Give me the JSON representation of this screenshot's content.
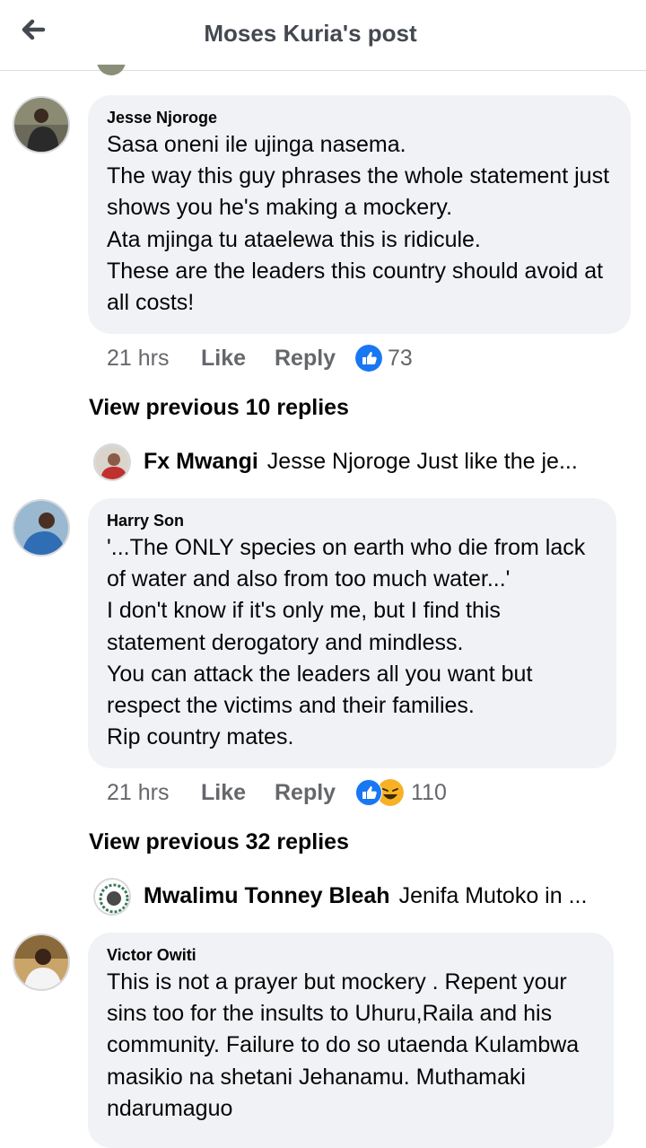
{
  "header": {
    "title": "Moses Kuria's post"
  },
  "comments": [
    {
      "name": "Jesse Njoroge",
      "text": "Sasa oneni ile ujinga nasema.\nThe way this guy phrases the whole statement just shows you he's making a mockery.\nAta mjinga tu ataelewa this is ridicule.\nThese are the leaders this country should avoid at all costs!",
      "time": "21 hrs",
      "like_label": "Like",
      "reply_label": "Reply",
      "reaction_count": "73",
      "view_previous": "View previous 10 replies",
      "latest_reply": {
        "name": "Fx Mwangi",
        "text": "Jesse Njoroge Just like the je..."
      }
    },
    {
      "name": "Harry Son",
      "text": "'...The ONLY species on earth who die from lack of water and also from too much water...'\nI don't know if it's only me, but I find this statement derogatory and mindless.\nYou can attack the leaders all you want but respect the victims and their families.\nRip country mates.",
      "time": "21 hrs",
      "like_label": "Like",
      "reply_label": "Reply",
      "reaction_count": "110",
      "view_previous": "View previous 32 replies",
      "latest_reply": {
        "name": "Mwalimu Tonney Bleah",
        "text": "Jenifa Mutoko in ..."
      }
    },
    {
      "name": "Victor Owiti",
      "text": "This is not a prayer but mockery . Repent your sins too for the insults to Uhuru,Raila and his community. Failure to do so utaenda Kulambwa masikio na shetani Jehanamu. Muthamaki ndarumaguo"
    }
  ],
  "icons": {
    "back": "back-arrow-icon",
    "like_reaction": "like-reaction-icon",
    "haha_reaction": "haha-reaction-icon"
  },
  "colors": {
    "like_blue": "#1877f2",
    "bubble_bg": "#f0f2f5",
    "meta_gray": "#65676b",
    "haha_yellow": "#f7b125"
  }
}
